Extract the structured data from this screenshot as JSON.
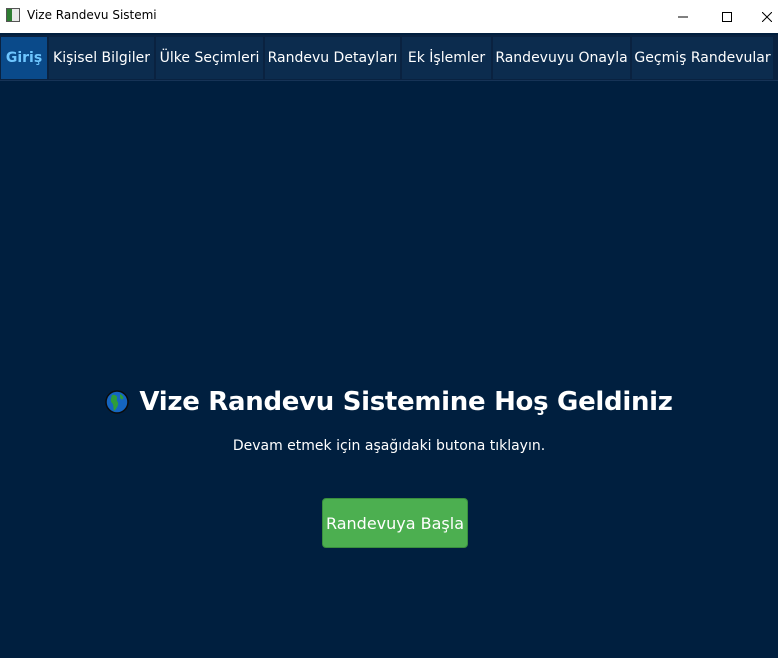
{
  "window": {
    "title": "Vize Randevu Sistemi",
    "background": "#001f3f"
  },
  "tabs": [
    {
      "label": "Giriş",
      "active": true
    },
    {
      "label": "Kişisel Bilgiler",
      "active": false
    },
    {
      "label": "Ülke Seçimleri",
      "active": false
    },
    {
      "label": "Randevu Detayları",
      "active": false
    },
    {
      "label": "Ek İşlemler",
      "active": false
    },
    {
      "label": "Randevuyu Onayla",
      "active": false
    },
    {
      "label": "Geçmiş Randevular",
      "active": false
    }
  ],
  "main": {
    "heading_icon": "globe-icon",
    "heading": "Vize Randevu Sistemine Hoş Geldiniz",
    "subtitle": "Devam etmek için aşağıdaki butona tıklayın.",
    "start_button_label": "Randevuya Başla",
    "start_button_color": "#4caf50"
  }
}
